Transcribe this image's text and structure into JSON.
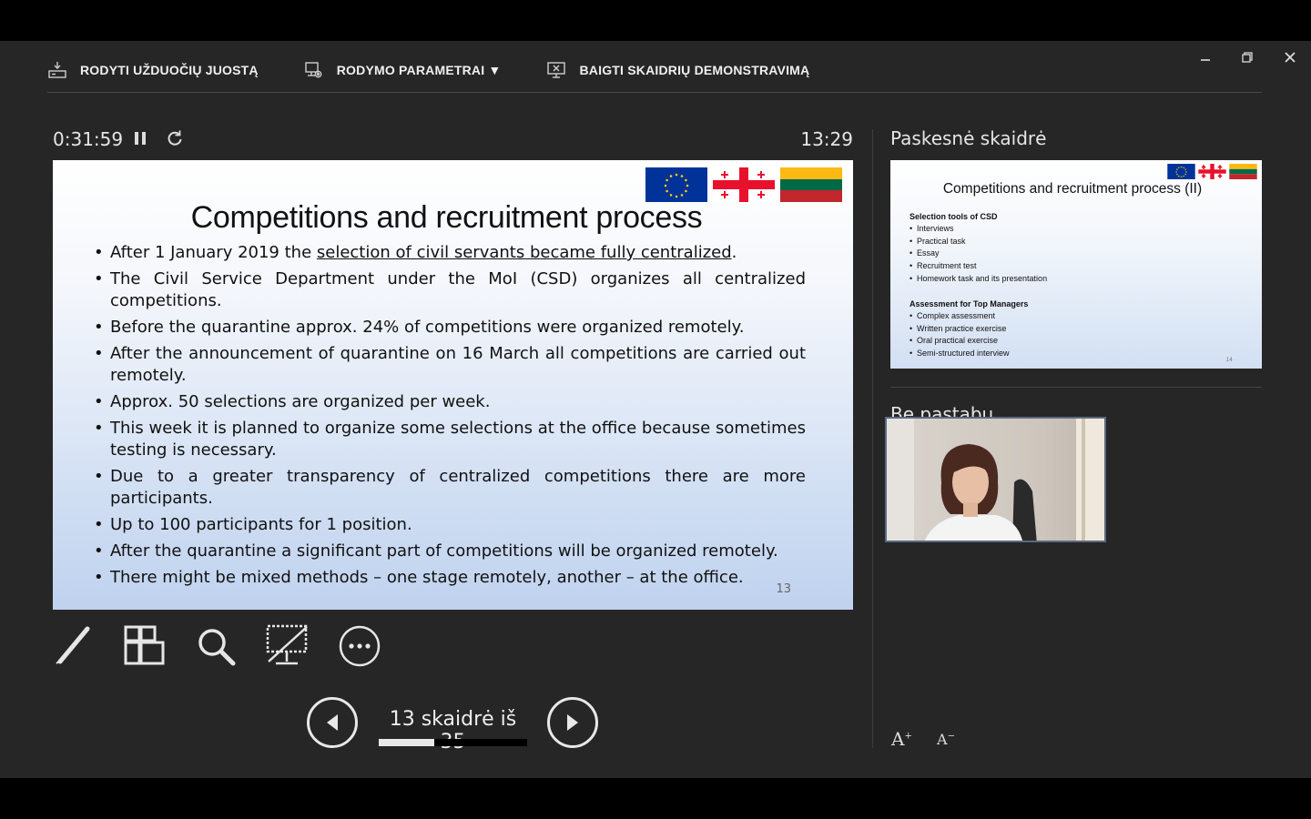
{
  "toolbar": {
    "show_taskbar": "RODYTI UŽDUOČIŲ JUOSTĄ",
    "display_settings": "RODYMO PARAMETRAI ▼",
    "end_slideshow": "BAIGTI SKAIDRIŲ DEMONSTRAVIMĄ"
  },
  "timer": {
    "elapsed": "0:31:59",
    "clock": "13:29"
  },
  "slide": {
    "title": "Competitions and recruitment process",
    "bullets": [
      {
        "before": "After 1 January 2019 the ",
        "underlined": "selection of civil servants became fully centralized",
        "after": "."
      },
      {
        "text": "The Civil Service Department under the MoI (CSD) organizes all centralized competitions."
      },
      {
        "text": "Before the quarantine approx. 24% of competitions were organized remotely."
      },
      {
        "text": "After the announcement of quarantine on 16 March all competitions are carried out remotely."
      },
      {
        "text": "Approx. 50 selections are organized per week."
      },
      {
        "text": "This week it is planned to organize some selections at the office because sometimes testing is necessary."
      },
      {
        "text": "Due to a greater transparency of centralized competitions there are more participants."
      },
      {
        "text": "Up to 100 participants for 1 position."
      },
      {
        "text": "After the quarantine a significant part of competitions will be organized remotely."
      },
      {
        "text": "There might be mixed methods – one stage remotely, another – at the office."
      }
    ],
    "number": "13"
  },
  "navigation": {
    "counter": "13 skaidrė iš 35",
    "current": 13,
    "total": 35
  },
  "next_slide": {
    "label": "Paskesnė skaidrė",
    "title": "Competitions and recruitment process (II)",
    "section1": "Selection tools of CSD",
    "items1": [
      "Interviews",
      "Practical task",
      "Essay",
      "Recruitment test",
      "Homework task and its presentation"
    ],
    "section2": "Assessment for Top Managers",
    "items2": [
      "Complex assessment",
      "Written practice exercise",
      "Oral practical exercise",
      "Semi-structured interview"
    ],
    "number": "14"
  },
  "notes": {
    "label": "Be pastabų"
  },
  "font_controls": {
    "increase": "A",
    "decrease": "A"
  },
  "colors": {
    "background": "#262626",
    "eu_blue": "#003399",
    "eu_gold": "#ffcc00",
    "georgia_red": "#e8112d",
    "lt_yellow": "#fdb913",
    "lt_green": "#006a44",
    "lt_red": "#c1272d"
  }
}
